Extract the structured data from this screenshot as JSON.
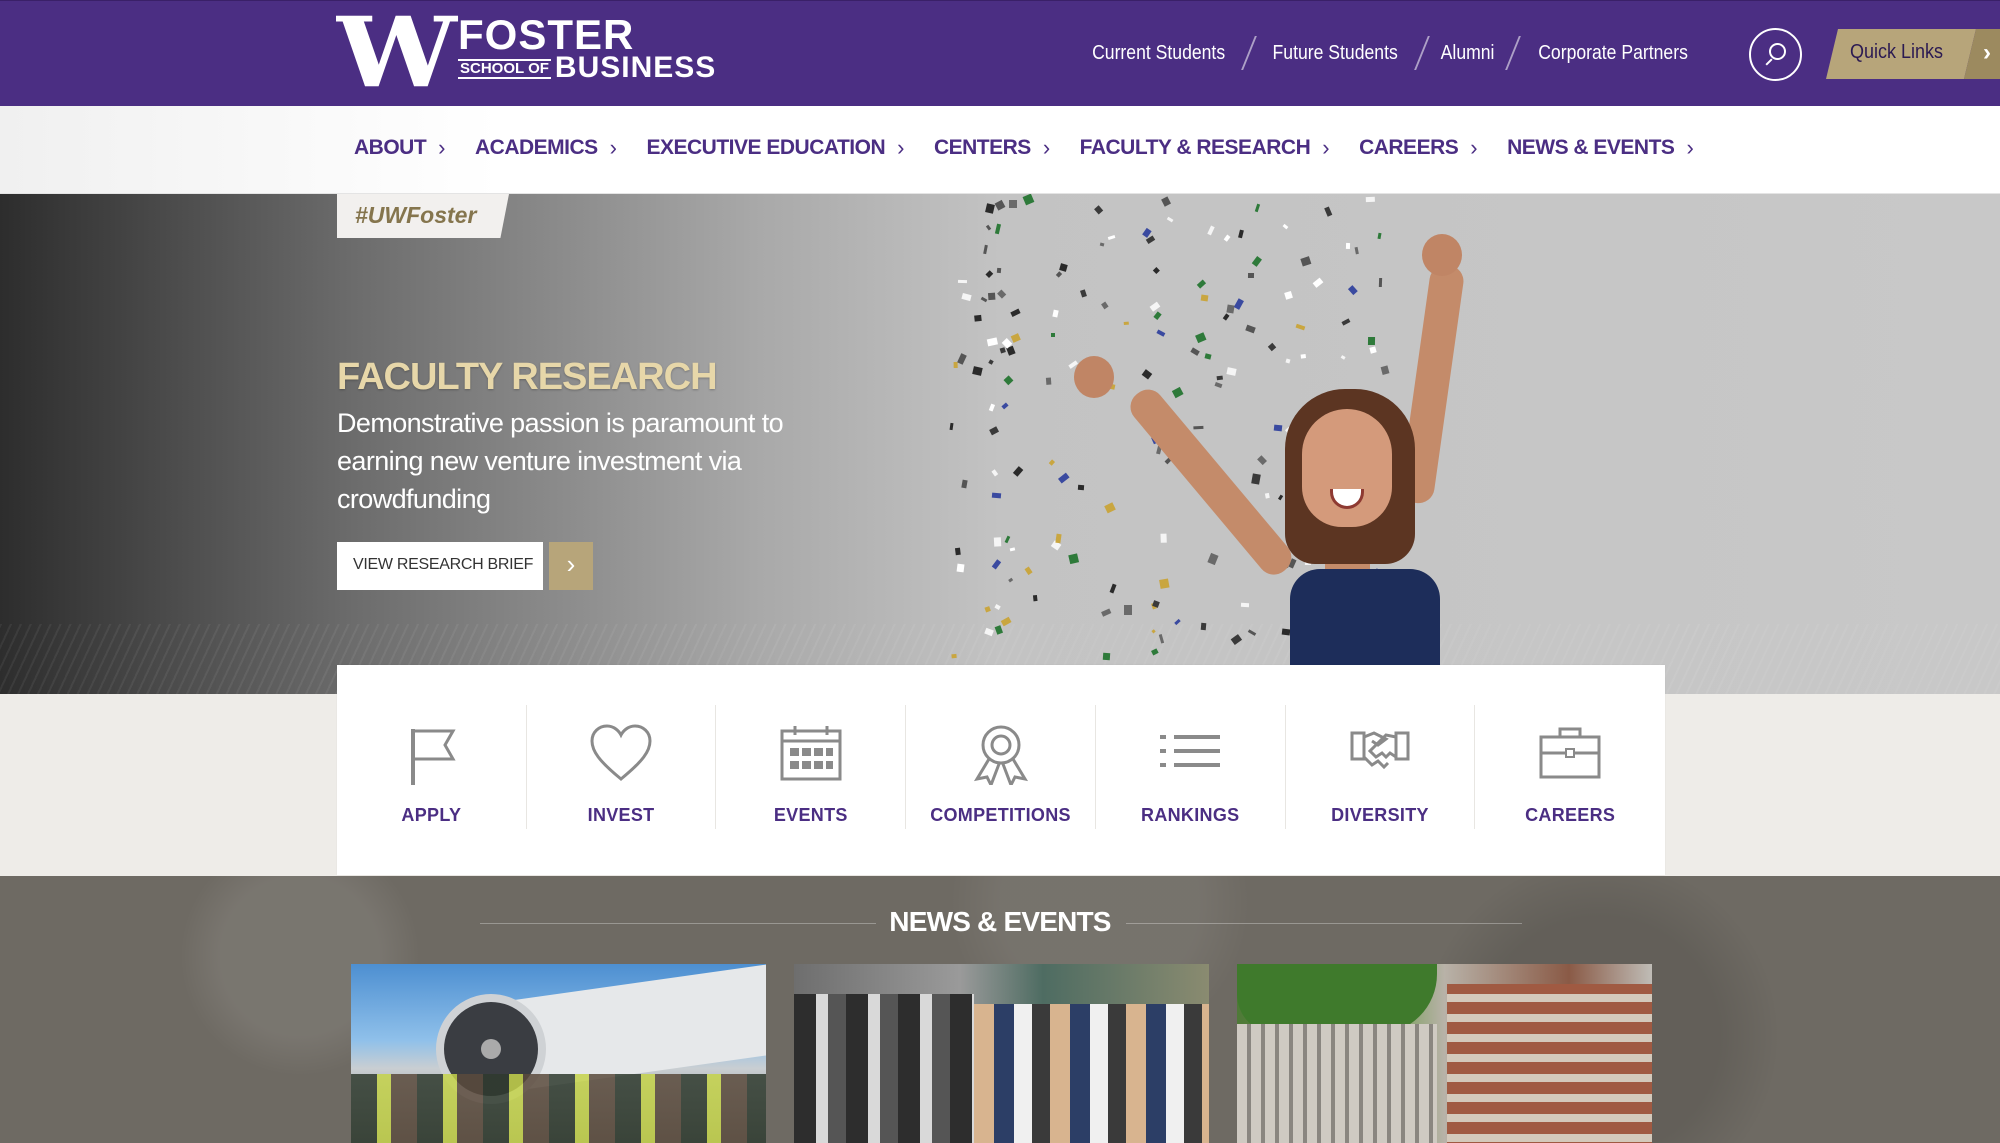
{
  "header": {
    "logo": {
      "letter": "W",
      "line1": "FOSTER",
      "line2_small": "SCHOOL OF",
      "line2_big": "BUSINESS"
    },
    "audience_links": [
      "Current Students",
      "Future Students",
      "Alumni",
      "Corporate Partners"
    ],
    "quick_links_label": "Quick Links",
    "colors": {
      "purple": "#4b2e83",
      "gold": "#b7a57a"
    }
  },
  "nav": {
    "items": [
      "ABOUT",
      "ACADEMICS",
      "EXECUTIVE EDUCATION",
      "CENTERS",
      "FACULTY & RESEARCH",
      "CAREERS",
      "NEWS & EVENTS"
    ]
  },
  "hero": {
    "hashtag": "#UWFoster",
    "title": "FACULTY RESEARCH",
    "subtitle": "Demonstrative passion is paramount to earning new venture investment via crowdfunding",
    "button_label": "VIEW RESEARCH BRIEF"
  },
  "actions": [
    {
      "label": "APPLY",
      "icon": "flag-icon"
    },
    {
      "label": "INVEST",
      "icon": "heart-icon"
    },
    {
      "label": "EVENTS",
      "icon": "calendar-icon"
    },
    {
      "label": "COMPETITIONS",
      "icon": "award-ribbon-icon"
    },
    {
      "label": "RANKINGS",
      "icon": "list-icon"
    },
    {
      "label": "DIVERSITY",
      "icon": "handshake-icon"
    },
    {
      "label": "CAREERS",
      "icon": "briefcase-icon"
    }
  ],
  "news": {
    "title": "NEWS & EVENTS"
  }
}
